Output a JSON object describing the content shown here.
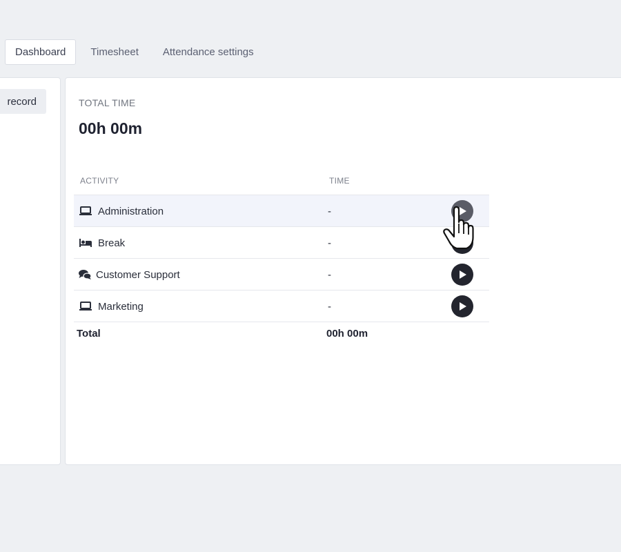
{
  "tabs": [
    {
      "label": "Dashboard",
      "active": true
    },
    {
      "label": "Timesheet",
      "active": false
    },
    {
      "label": "Attendance settings",
      "active": false
    }
  ],
  "left_panel": {
    "record_label": "record"
  },
  "summary": {
    "label": "TOTAL TIME",
    "value": "00h 00m"
  },
  "table": {
    "headers": {
      "activity": "ACTIVITY",
      "time": "TIME"
    },
    "rows": [
      {
        "name": "Administration",
        "icon": "laptop-icon",
        "time": "-"
      },
      {
        "name": "Break",
        "icon": "bed-icon",
        "time": "-"
      },
      {
        "name": "Customer Support",
        "icon": "chat-icon",
        "time": "-"
      },
      {
        "name": "Marketing",
        "icon": "laptop-icon",
        "time": "-"
      }
    ],
    "total": {
      "label": "Total",
      "value": "00h 00m"
    }
  },
  "colors": {
    "background": "#eef0f3",
    "accent_dark": "#23252e",
    "row_hover": "#f2f4fb"
  }
}
